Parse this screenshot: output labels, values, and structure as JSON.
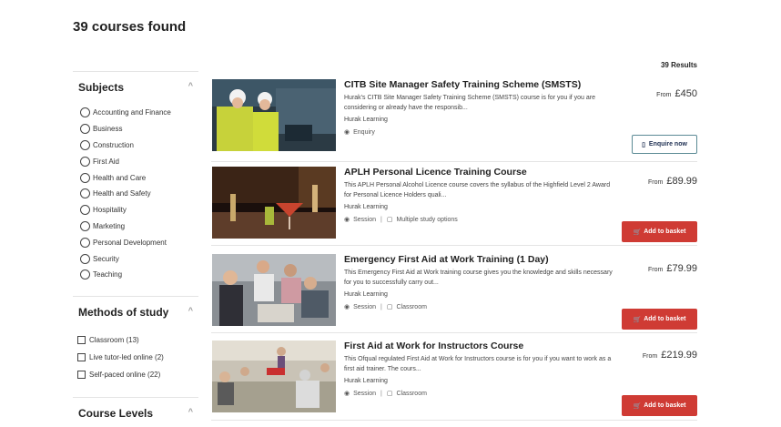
{
  "header": {
    "title": "39 courses found"
  },
  "results": {
    "count_label": "39 Results"
  },
  "sidebar": {
    "subjects": {
      "title": "Subjects",
      "items": [
        "Accounting and Finance",
        "Business",
        "Construction",
        "First Aid",
        "Health and Care",
        "Health and Safety",
        "Hospitality",
        "Marketing",
        "Personal Development",
        "Security",
        "Teaching"
      ]
    },
    "methods": {
      "title": "Methods of study",
      "items": [
        "Classroom (13)",
        "Live tutor-led online (2)",
        "Self-paced online (22)"
      ]
    },
    "levels": {
      "title": "Course Levels"
    }
  },
  "courses": [
    {
      "title": "CITB Site Manager Safety Training Scheme (SMSTS)",
      "description": "Hurak's CITB Site Manager Safety Training Scheme (SMSTS) course is for you if you are considering or already have the responsib...",
      "provider": "Hurak Learning",
      "meta1": "Enquiry",
      "meta2": "",
      "price_prefix": "From",
      "price": "£450",
      "action": "Enquire now"
    },
    {
      "title": "APLH Personal Licence Training Course",
      "description": "This APLH Personal Alcohol Licence course covers the syllabus of the Highfield Level 2 Award for Personal Licence Holders quali...",
      "provider": "Hurak Learning",
      "meta1": "Session",
      "meta2": "Multiple study options",
      "price_prefix": "From",
      "price": "£89.99",
      "action": "Add to basket"
    },
    {
      "title": "Emergency First Aid at Work Training (1 Day)",
      "description": "This Emergency First Aid at Work training course gives you the knowledge and skills necessary for you to successfully carry out...",
      "provider": "Hurak Learning",
      "meta1": "Session",
      "meta2": "Classroom",
      "price_prefix": "From",
      "price": "£79.99",
      "action": "Add to basket"
    },
    {
      "title": "First Aid at Work for Instructors Course",
      "description": "This Ofqual regulated First Aid at Work for Instructors course is for you if you want to work as a first aid trainer. The cours...",
      "provider": "Hurak Learning",
      "meta1": "Session",
      "meta2": "Classroom",
      "price_prefix": "From",
      "price": "£219.99",
      "action": "Add to basket"
    }
  ],
  "colors": {
    "accent_red": "#cf3b34",
    "enquire_border": "#5b8a95"
  }
}
